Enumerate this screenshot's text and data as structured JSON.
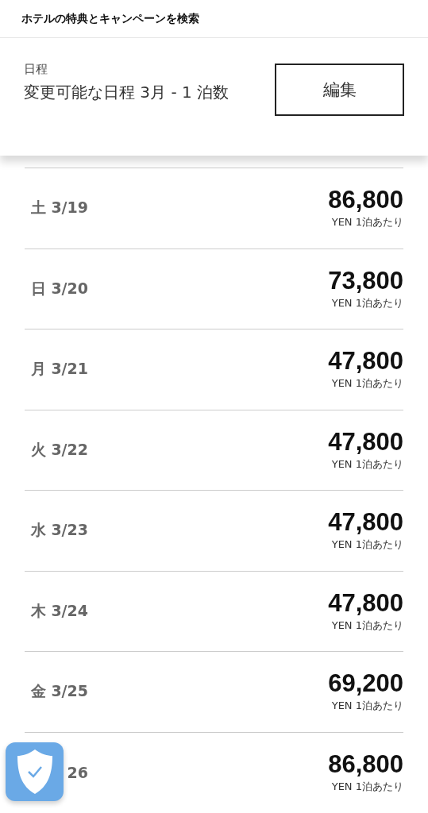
{
  "header": {
    "title": "ホテルの特典とキャンペーンを検索"
  },
  "dates_card": {
    "label": "日程",
    "value": "変更可能な日程 3月 - 1 泊数",
    "edit_button": "編集"
  },
  "rates": [
    {
      "date": "土 3/19",
      "price": "86,800",
      "unit": "YEN 1泊あたり"
    },
    {
      "date": "日 3/20",
      "price": "73,800",
      "unit": "YEN 1泊あたり"
    },
    {
      "date": "月 3/21",
      "price": "47,800",
      "unit": "YEN 1泊あたり"
    },
    {
      "date": "火 3/22",
      "price": "47,800",
      "unit": "YEN 1泊あたり"
    },
    {
      "date": "水 3/23",
      "price": "47,800",
      "unit": "YEN 1泊あたり"
    },
    {
      "date": "木 3/24",
      "price": "47,800",
      "unit": "YEN 1泊あたり"
    },
    {
      "date": "金 3/25",
      "price": "69,200",
      "unit": "YEN 1泊あたり"
    },
    {
      "date": "26",
      "price": "86,800",
      "unit": "YEN 1泊あたり"
    }
  ]
}
